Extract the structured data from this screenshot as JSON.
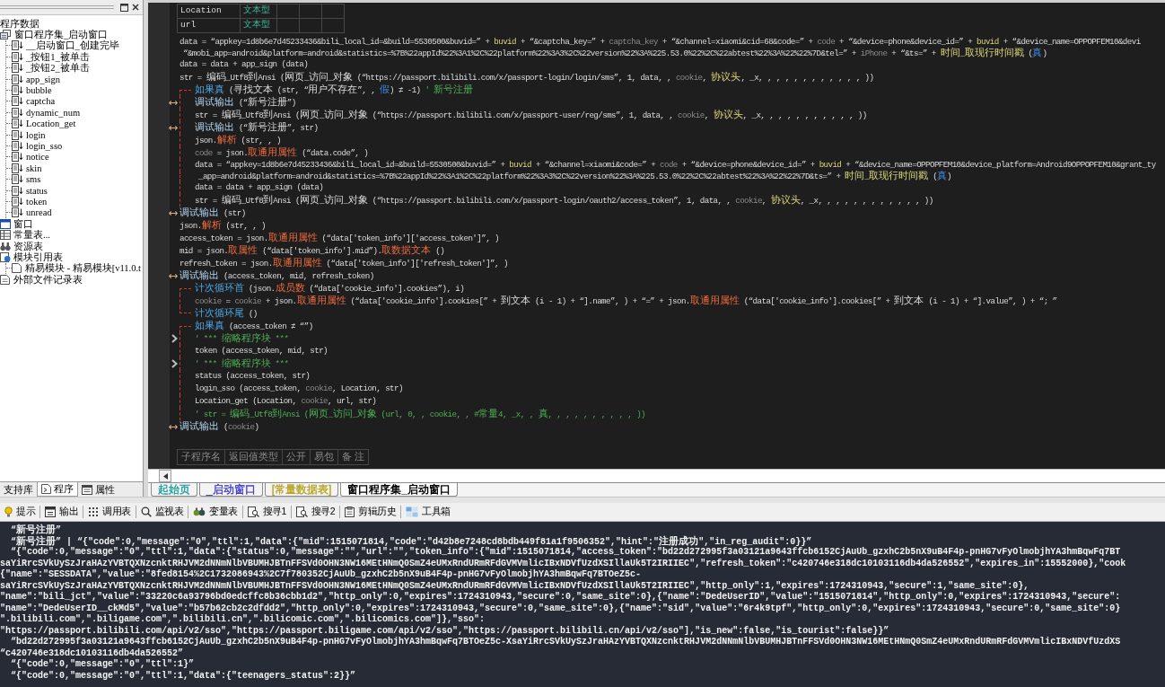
{
  "sidebar": {
    "tree": [
      {
        "label": "程序数据",
        "children": [
          {
            "label": "窗口程序集_启动窗口",
            "kind": "class",
            "children": [
              {
                "label": "__启动窗口_创建完毕",
                "kind": "sub"
              },
              {
                "label": "_按钮1_被单击",
                "kind": "sub"
              },
              {
                "label": "_按钮2_被单击",
                "kind": "sub"
              },
              {
                "label": "app_sign",
                "kind": "sub"
              },
              {
                "label": "bubble",
                "kind": "sub"
              },
              {
                "label": "captcha",
                "kind": "sub"
              },
              {
                "label": "dynamic_num",
                "kind": "sub"
              },
              {
                "label": "Location_get",
                "kind": "sub"
              },
              {
                "label": "login",
                "kind": "sub"
              },
              {
                "label": "login_sso",
                "kind": "sub"
              },
              {
                "label": "notice",
                "kind": "sub"
              },
              {
                "label": "skin",
                "kind": "sub"
              },
              {
                "label": "sms",
                "kind": "sub"
              },
              {
                "label": "status",
                "kind": "sub"
              },
              {
                "label": "token",
                "kind": "sub"
              },
              {
                "label": "unread",
                "kind": "sub"
              }
            ]
          },
          {
            "label": "窗口",
            "kind": "window"
          },
          {
            "label": "常量表...",
            "kind": "constants"
          },
          {
            "label": "资源表",
            "kind": "resources"
          },
          {
            "label": "模块引用表",
            "kind": "module-refs",
            "children": [
              {
                "label": "精易模块 - 精易模块[v11.0.t",
                "kind": "module"
              }
            ]
          },
          {
            "label": "外部文件记录表",
            "kind": "external-files"
          }
        ]
      }
    ],
    "tabs": [
      {
        "label": "支持库",
        "kind": "library",
        "selected": false
      },
      {
        "label": "程序",
        "kind": "program",
        "selected": true
      },
      {
        "label": "属性",
        "kind": "properties",
        "selected": false
      }
    ]
  },
  "editor": {
    "vars_table": {
      "rows": [
        {
          "name": "Location",
          "type": "文本型"
        },
        {
          "name": "url",
          "type": "文本型"
        }
      ]
    },
    "lines": [
      {
        "kind": "line",
        "segs": [
          {
            "kind": "p",
            "text": "data = “appkey=1d8b6e7d45233436&bili_local_id=&build=5530500&buvid=” + "
          },
          {
            "kind": "y",
            "text": "buvid"
          },
          {
            "kind": "p",
            "text": " + “&captcha_key=” + "
          },
          {
            "kind": "d",
            "text": "captcha_key"
          },
          {
            "kind": "p",
            "text": " + “&channel=xiaomi&cid=68&code=” + "
          },
          {
            "kind": "d",
            "text": "code"
          },
          {
            "kind": "p",
            "text": " + “&device=phone&device_id=” + "
          },
          {
            "kind": "y",
            "text": "buvid"
          },
          {
            "kind": "p",
            "text": " + “&device_name=OPPOPFEM10&devi"
          }
        ]
      },
      {
        "kind": "wrap",
        "segs": [
          {
            "kind": "p",
            "text": "“&mobi_app=android&platform=android&statistics=%7B%22appId%22%3A1%2C%22platform%22%3A3%2C%22version%22%3A%225.53.0%22%2C%22abtest%22%3A%22%22%7D&tel=” + "
          },
          {
            "kind": "d",
            "text": "iPhone"
          },
          {
            "kind": "p",
            "text": " + “&ts=” + "
          },
          {
            "kind": "y",
            "text": "时间_取现行时间戳"
          },
          {
            "kind": "p",
            "text": " ("
          },
          {
            "kind": "c",
            "text": "真"
          },
          {
            "kind": "p",
            "text": ")"
          }
        ]
      },
      {
        "kind": "line",
        "segs": [
          {
            "kind": "p",
            "text": "data = data + app_sign (data)"
          }
        ]
      },
      {
        "kind": "line",
        "segs": [
          {
            "kind": "p",
            "text": "str = 编码_Utf8到Ansi (网页_访问_对象 (“https://passport.bilibili.com/x/passport-login/login/sms”, 1, data, , "
          },
          {
            "kind": "d",
            "text": "cookie"
          },
          {
            "kind": "p",
            "text": ", "
          },
          {
            "kind": "y",
            "text": "协议头"
          },
          {
            "kind": "p",
            "text": ", _x, , , , , , , , , , , , ))"
          }
        ]
      },
      {
        "kind": "block",
        "segs": [
          {
            "kind": "b",
            "text": "如果真"
          },
          {
            "kind": "p",
            "text": " (寻找文本 (str, “用户不存在”, , "
          },
          {
            "kind": "c",
            "text": "假"
          },
          {
            "kind": "p",
            "text": ") ≠ -1) "
          },
          {
            "kind": "g",
            "text": "' 新号注册"
          }
        ],
        "children": [
          {
            "kind": "line",
            "gutter": {
              "kind": "output"
            },
            "segs": [
              {
                "kind": "k",
                "text": "调试输出"
              },
              {
                "kind": "p",
                "text": " (“新号注册”)"
              }
            ]
          },
          {
            "kind": "line",
            "segs": [
              {
                "kind": "p",
                "text": "str = 编码_Utf8到Ansi (网页_访问_对象 (“https://passport.bilibili.com/x/passport-user/reg/sms”, 1, data, , "
              },
              {
                "kind": "d",
                "text": "cookie"
              },
              {
                "kind": "p",
                "text": ", "
              },
              {
                "kind": "y",
                "text": "协议头"
              },
              {
                "kind": "p",
                "text": ", _x, , , , , , , , , , , ))"
              }
            ]
          },
          {
            "kind": "line",
            "gutter": {
              "kind": "output"
            },
            "segs": [
              {
                "kind": "k",
                "text": "调试输出"
              },
              {
                "kind": "p",
                "text": " (“新号注册”, str)"
              }
            ]
          },
          {
            "kind": "line",
            "segs": [
              {
                "kind": "p",
                "text": "json."
              },
              {
                "kind": "m",
                "text": "解析"
              },
              {
                "kind": "p",
                "text": " (str, , )"
              }
            ]
          },
          {
            "kind": "line",
            "segs": [
              {
                "kind": "d",
                "text": "code"
              },
              {
                "kind": "p",
                "text": " = json."
              },
              {
                "kind": "m",
                "text": "取通用属性"
              },
              {
                "kind": "p",
                "text": " (“data.code”, )"
              }
            ]
          },
          {
            "kind": "line",
            "segs": [
              {
                "kind": "p",
                "text": "data = “appkey=1d8b6e7d45233436&bili_local_id=&build=5530500&buvid=” + "
              },
              {
                "kind": "y",
                "text": "buvid"
              },
              {
                "kind": "p",
                "text": " + “&channel=xiaomi&code=” + "
              },
              {
                "kind": "d",
                "text": "code"
              },
              {
                "kind": "p",
                "text": " + “&device=phone&device_id=” + "
              },
              {
                "kind": "y",
                "text": "buvid"
              },
              {
                "kind": "p",
                "text": " + “&device_name=OPPOPFEM10&device_platform=Android9OPPOPFEM10&grant_ty"
              }
            ]
          },
          {
            "kind": "wrap",
            "segs": [
              {
                "kind": "p",
                "text": "_app=android&platform=android&statistics=%7B%22appId%22%3A1%2C%22platform%22%3A3%2C%22version%22%3A%225.53.0%22%2C%22abtest%22%3A%22%22%7D&ts=” + "
              },
              {
                "kind": "y",
                "text": "时间_取现行时间戳"
              },
              {
                "kind": "p",
                "text": " ("
              },
              {
                "kind": "c",
                "text": "真"
              },
              {
                "kind": "p",
                "text": ")"
              }
            ]
          },
          {
            "kind": "line",
            "segs": [
              {
                "kind": "p",
                "text": "data = data + app_sign (data)"
              }
            ]
          },
          {
            "kind": "line",
            "segs": [
              {
                "kind": "p",
                "text": "str = 编码_Utf8到Ansi (网页_访问_对象 (“https://passport.bilibili.com/x/passport-login/oauth2/access_token”, 1, data, , "
              },
              {
                "kind": "d",
                "text": "cookie"
              },
              {
                "kind": "p",
                "text": ", "
              },
              {
                "kind": "y",
                "text": "协议头"
              },
              {
                "kind": "p",
                "text": ", _x, , , , , , , , , , , , ))"
              }
            ]
          }
        ]
      },
      {
        "kind": "line",
        "gutter": {
          "kind": "output"
        },
        "segs": [
          {
            "kind": "k",
            "text": "调试输出"
          },
          {
            "kind": "p",
            "text": " (str)"
          }
        ]
      },
      {
        "kind": "line",
        "segs": [
          {
            "kind": "p",
            "text": "json."
          },
          {
            "kind": "m",
            "text": "解析"
          },
          {
            "kind": "p",
            "text": " (str, , )"
          }
        ]
      },
      {
        "kind": "line",
        "segs": [
          {
            "kind": "p",
            "text": "access_token = json."
          },
          {
            "kind": "m",
            "text": "取通用属性"
          },
          {
            "kind": "p",
            "text": " (“data['token_info']['access_token']”, )"
          }
        ]
      },
      {
        "kind": "line",
        "segs": [
          {
            "kind": "p",
            "text": "mid = json."
          },
          {
            "kind": "m",
            "text": "取属性"
          },
          {
            "kind": "p",
            "text": " (“data['token_info'].mid”)."
          },
          {
            "kind": "m",
            "text": "取数据文本"
          },
          {
            "kind": "p",
            "text": " ()"
          }
        ]
      },
      {
        "kind": "line",
        "segs": [
          {
            "kind": "p",
            "text": "refresh_token = json."
          },
          {
            "kind": "m",
            "text": "取通用属性"
          },
          {
            "kind": "p",
            "text": " (“data['token_info']['refresh_token']”, )"
          }
        ]
      },
      {
        "kind": "line",
        "gutter": {
          "kind": "output"
        },
        "segs": [
          {
            "kind": "k",
            "text": "调试输出"
          },
          {
            "kind": "p",
            "text": " (access_token, mid, refresh_token)"
          }
        ]
      },
      {
        "kind": "block",
        "segs": [
          {
            "kind": "b",
            "text": "计次循环首"
          },
          {
            "kind": "p",
            "text": " (json."
          },
          {
            "kind": "m",
            "text": "成员数"
          },
          {
            "kind": "p",
            "text": " (“data['cookie_info'].cookies”), i)"
          }
        ],
        "children": [
          {
            "kind": "line",
            "segs": [
              {
                "kind": "d",
                "text": "cookie"
              },
              {
                "kind": "p",
                "text": " = "
              },
              {
                "kind": "d",
                "text": "cookie"
              },
              {
                "kind": "p",
                "text": " + json."
              },
              {
                "kind": "m",
                "text": "取通用属性"
              },
              {
                "kind": "p",
                "text": " (“data['cookie_info'].cookies[” + 到文本 (i - 1) + “].name”, ) + “=” + json."
              },
              {
                "kind": "m",
                "text": "取通用属性"
              },
              {
                "kind": "p",
                "text": " (“data['cookie_info'].cookies[” + 到文本 (i - 1) + “].value”, ) + “; ”"
              }
            ]
          }
        ],
        "tail": {
          "segs": [
            {
              "kind": "b",
              "text": "计次循环尾"
            },
            {
              "kind": "p",
              "text": " ()"
            }
          ]
        }
      },
      {
        "kind": "block",
        "segs": [
          {
            "kind": "b",
            "text": "如果真"
          },
          {
            "kind": "p",
            "text": " (access_token ≠ “”)"
          }
        ],
        "children": [
          {
            "kind": "line",
            "gutter": {
              "kind": "fold"
            },
            "segs": [
              {
                "kind": "g",
                "text": "' *** 缩略程序块 ***"
              }
            ]
          },
          {
            "kind": "line",
            "segs": [
              {
                "kind": "p",
                "text": "token (access_token, mid, str)"
              }
            ]
          },
          {
            "kind": "line",
            "gutter": {
              "kind": "fold"
            },
            "segs": [
              {
                "kind": "g",
                "text": "' *** 缩略程序块 ***"
              }
            ]
          },
          {
            "kind": "line",
            "segs": [
              {
                "kind": "p",
                "text": "status (access_token, str)"
              }
            ]
          },
          {
            "kind": "line",
            "segs": [
              {
                "kind": "p",
                "text": "login_sso (access_token, "
              },
              {
                "kind": "d",
                "text": "cookie"
              },
              {
                "kind": "p",
                "text": ", Location, str)"
              }
            ]
          },
          {
            "kind": "line",
            "segs": [
              {
                "kind": "p",
                "text": "Location_get (Location, "
              },
              {
                "kind": "d",
                "text": "cookie"
              },
              {
                "kind": "p",
                "text": ", url, str)"
              }
            ]
          },
          {
            "kind": "line",
            "segs": [
              {
                "kind": "g",
                "text": "' str = 编码_Utf8到Ansi (网页_访问_对象 (url, 0, , cookie, , #常量4, _x, , 真, , , , , , , , , , ))"
              }
            ]
          }
        ]
      },
      {
        "kind": "line",
        "gutter": {
          "kind": "output"
        },
        "segs": [
          {
            "kind": "k",
            "text": "调试输出"
          },
          {
            "kind": "p",
            "text": " ("
          },
          {
            "kind": "d",
            "text": "cookie"
          },
          {
            "kind": "p",
            "text": ")"
          }
        ]
      }
    ],
    "sub_table": {
      "columns": [
        "子程序名",
        "返回值类型",
        "公开",
        "易包",
        "备 注"
      ]
    },
    "doc_tabs": [
      {
        "label": "起始页",
        "color": "#1a9c9c",
        "selected": false
      },
      {
        "label": "_启动窗口",
        "color": "#3b3bd0",
        "selected": false
      },
      {
        "label": "[常量数据表]",
        "color": "#b5a321",
        "selected": false
      },
      {
        "label": "窗口程序集_启动窗口",
        "color": "#000000",
        "selected": true
      }
    ]
  },
  "toolbar": [
    {
      "label": "提示",
      "kind": "hint"
    },
    {
      "label": "输出",
      "kind": "output"
    },
    {
      "label": "调用表",
      "kind": "calls"
    },
    {
      "label": "监视表",
      "kind": "watch"
    },
    {
      "label": "变量表",
      "kind": "vars"
    },
    {
      "label": "搜寻1",
      "kind": "find"
    },
    {
      "label": "搜寻2",
      "kind": "find"
    },
    {
      "label": "剪辑历史",
      "kind": "clips"
    },
    {
      "label": "工具箱",
      "kind": "toolbox"
    }
  ],
  "output": {
    "lines": [
      {
        "kind": "indented",
        "text": "“新号注册”"
      },
      {
        "kind": "indented",
        "text": "“新号注册” | “{\"code\":0,\"message\":\"0\",\"ttl\":1,\"data\":{\"mid\":1515071814,\"code\":\"d42b8e7248cd8bdb449f81a1f9506352\",\"hint\":\"注册成功\",\"in_reg_audit\":0}}”"
      },
      {
        "kind": "indented",
        "text": "“{\"code\":0,\"message\":\"0\",\"ttl\":1,\"data\":{\"status\":0,\"message\":\"\",\"url\":\"\",\"token_info\":{\"mid\":1515071814,\"access_token\":\"bd22d272995f3a03121a9643ffcb6152CjAuUb_gzxhC2b5nX9uB4F4p-pnHG7vFyOlmobjhYA3hmBqwFq7BT"
      },
      {
        "kind": "flush",
        "text": "saYiRrcSVkUySzJraHAzYVBTQXNzcnktRHJVM2dNNmNlbVBUMHJBTnFFSVd0OHN3NW16MEtHNmQ0SmZ4eUMxRndURmRFdGVMVmlicIBxNDVfUzdXSIllaUk5T2IRIIEC\",\"refresh_token\":\"c420746e318dc10103116db4da526552\",\"expires_in\":15552000},\"cook"
      },
      {
        "kind": "flush",
        "text": "{\"name\":\"SESSDATA\",\"value\":\"8fed8154%2C1732086943%2C7f780352CjAuUb_gzxhC2b5nX9uB4F4p-pnHG7vFyOlmobjhYA3hmBqwFq7BTOeZ5c-"
      },
      {
        "kind": "flush",
        "text": "saYiRrcSVkUySzJraHAzYVBTQXNzcnktRHJVM2dNNmNlbVBUMHJBTnFFSVd0OHN3NW16MEtHNmQ0SmZ4eUMxRndURmRFdGVMVmlicIBxNDVfUzdXSIllaUk5T2IRIIEC\",\"http_only\":1,\"expires\":1724310943,\"secure\":1,\"same_site\":0},"
      },
      {
        "kind": "flush",
        "text": "\"name\":\"bili_jct\",\"value\":\"33220c6a93796bd0edcffc8b36cbb1d2\",\"http_only\":0,\"expires\":1724310943,\"secure\":0,\"same_site\":0},{\"name\":\"DedeUserID\",\"value\":\"1515071814\",\"http_only\":0,\"expires\":1724310943,\"secure\":"
      },
      {
        "kind": "flush",
        "text": "\"name\":\"DedeUserID__ckMd5\",\"value\":\"b57b62cb2c2dfdd2\",\"http_only\":0,\"expires\":1724310943,\"secure\":0,\"same_site\":0},{\"name\":\"sid\",\"value\":\"6r4k9tpf\",\"http_only\":0,\"expires\":1724310943,\"secure\":0,\"same_site\":0}"
      },
      {
        "kind": "flush",
        "text": "\".bilibili.com\",\".biligame.com\",\".bilibili.cn\",\".bilicomic.com\",\".bilicomics.com\"]},\"sso\":"
      },
      {
        "kind": "flush",
        "text": "\"https://passport.bilibili.com/api/v2/sso\",\"https://passport.biligame.com/api/v2/sso\",\"https://passport.bilibili.cn/api/v2/sso\"],\"is_new\":false,\"is_tourist\":false}}”"
      },
      {
        "kind": "indented",
        "text": "“bd22d272995f3a03121a9643ffcb6152CjAuUb_gzxhC2b5nX9uB4F4p-pnHG7vFyOlmobjhYA3hmBqwFq7BTOeZ5c-XsaYiRrcSVkUySzJraHAzYVBTQXNzcnktRHJVM2dNNmNlbVBUMHJBTnFFSVd0OHN3NW16MEtHNmQ0SmZ4eUMxRndURmRFdGVMVmlicIBxNDVfUzdXS"
      },
      {
        "kind": "flush",
        "text": "“c420746e318dc10103116db4da526552”"
      },
      {
        "kind": "indented",
        "text": "“{\"code\":0,\"message\":\"0\",\"ttl\":1}”"
      },
      {
        "kind": "indented",
        "text": "“{\"code\":0,\"message\":\"0\",\"ttl\":1,\"data\":{\"teenagers_status\":2}}”"
      }
    ]
  }
}
